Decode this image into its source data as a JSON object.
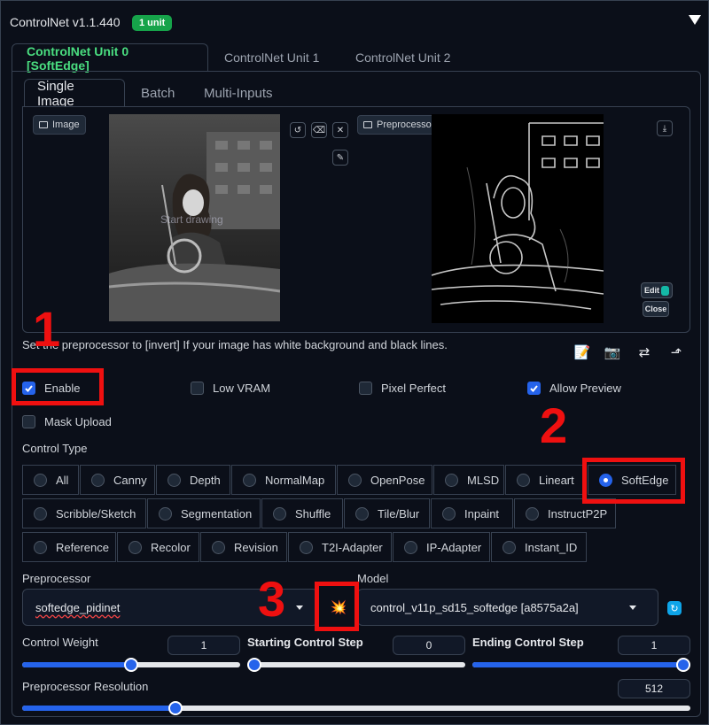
{
  "header": {
    "title": "ControlNet v1.1.440",
    "badge": "1 unit"
  },
  "unit_tabs": [
    {
      "label": "ControlNet Unit 0 [SoftEdge]",
      "active": true
    },
    {
      "label": "ControlNet Unit 1",
      "active": false
    },
    {
      "label": "ControlNet Unit 2",
      "active": false
    }
  ],
  "input_tabs": [
    {
      "label": "Single Image",
      "active": true
    },
    {
      "label": "Batch",
      "active": false
    },
    {
      "label": "Multi-Inputs",
      "active": false
    }
  ],
  "image_panel": {
    "label": "Image",
    "overlay_text": "Start drawing"
  },
  "preview_panel": {
    "label": "Preprocessor Preview",
    "edit_label": "Edit",
    "close_label": "Close"
  },
  "helper_text": "Set the preprocessor to [invert] If your image has white background and black lines.",
  "checkboxes": {
    "enable": {
      "label": "Enable",
      "checked": true
    },
    "low_vram": {
      "label": "Low VRAM",
      "checked": false
    },
    "pixel_perfect": {
      "label": "Pixel Perfect",
      "checked": false
    },
    "allow_preview": {
      "label": "Allow Preview",
      "checked": true
    },
    "mask_upload": {
      "label": "Mask Upload",
      "checked": false
    }
  },
  "control_type": {
    "label": "Control Type",
    "rows": [
      [
        "All",
        "Canny",
        "Depth",
        "NormalMap",
        "OpenPose",
        "MLSD",
        "Lineart",
        "SoftEdge"
      ],
      [
        "Scribble/Sketch",
        "Segmentation",
        "Shuffle",
        "Tile/Blur",
        "Inpaint",
        "InstructP2P"
      ],
      [
        "Reference",
        "Recolor",
        "Revision",
        "T2I-Adapter",
        "IP-Adapter",
        "Instant_ID"
      ]
    ],
    "selected": "SoftEdge"
  },
  "preprocessor": {
    "label": "Preprocessor",
    "value": "softedge_pidinet"
  },
  "model": {
    "label": "Model",
    "value": "control_v11p_sd15_softedge [a8575a2a]"
  },
  "control_weight": {
    "label": "Control Weight",
    "value": "1",
    "fraction": 0.5
  },
  "starting_step": {
    "label": "Starting Control Step",
    "value": "0",
    "fraction": 0.0
  },
  "ending_step": {
    "label": "Ending Control Step",
    "value": "1",
    "fraction": 1.0
  },
  "preprocessor_resolution": {
    "label": "Preprocessor Resolution",
    "value": "512",
    "fraction": 0.23
  },
  "annotations": [
    "1",
    "2",
    "3"
  ],
  "colors": {
    "accent": "#2563eb",
    "active_tab": "#4ade80",
    "badge": "#16a34a",
    "highlight": "#ef1010"
  }
}
